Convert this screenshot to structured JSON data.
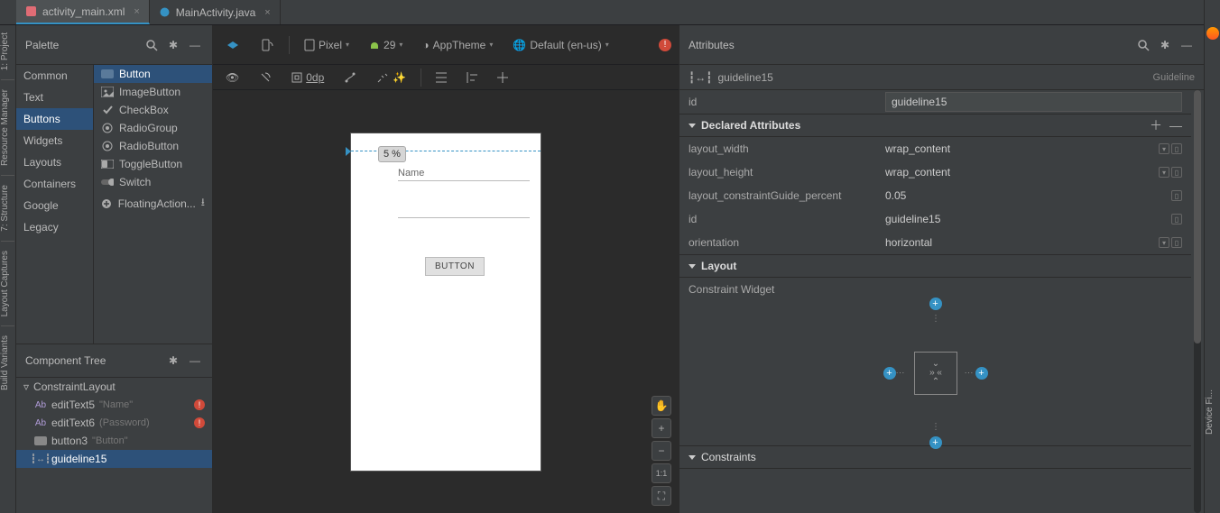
{
  "tabs": [
    {
      "name": "activity_main.xml",
      "active": true,
      "color": "#e06c75"
    },
    {
      "name": "MainActivity.java",
      "active": false,
      "color": "#3592c4"
    }
  ],
  "left_rail": [
    "1: Project",
    "Resource Manager",
    "7: Structure",
    "Layout Captures",
    "Build Variants"
  ],
  "right_rail": [
    "Device Fi..."
  ],
  "palette": {
    "title": "Palette",
    "categories": [
      "Common",
      "Text",
      "Buttons",
      "Widgets",
      "Layouts",
      "Containers",
      "Google",
      "Legacy"
    ],
    "selected_category": "Buttons",
    "widgets": [
      {
        "label": "Button",
        "icon": "button"
      },
      {
        "label": "ImageButton",
        "icon": "image"
      },
      {
        "label": "CheckBox",
        "icon": "check"
      },
      {
        "label": "RadioGroup",
        "icon": "radiogrp"
      },
      {
        "label": "RadioButton",
        "icon": "radio"
      },
      {
        "label": "ToggleButton",
        "icon": "toggle"
      },
      {
        "label": "Switch",
        "icon": "switch"
      },
      {
        "label": "FloatingAction...",
        "icon": "fab"
      }
    ],
    "selected_widget": "Button"
  },
  "component_tree": {
    "title": "Component Tree",
    "root": "ConstraintLayout",
    "children": [
      {
        "id": "editText5",
        "hint": "\"Name\"",
        "err": true,
        "icon": "text"
      },
      {
        "id": "editText6",
        "hint": "(Password)",
        "err": true,
        "icon": "text"
      },
      {
        "id": "button3",
        "hint": "\"Button\"",
        "err": false,
        "icon": "button"
      },
      {
        "id": "guideline15",
        "hint": "",
        "err": false,
        "icon": "guide",
        "sel": true
      }
    ]
  },
  "editor": {
    "device": "Pixel",
    "api": "29",
    "theme": "AppTheme",
    "locale": "Default (en-us)",
    "margin": "0dp",
    "guideline_pct": "5 %",
    "preview": {
      "name_label": "Name",
      "button_label": "BUTTON"
    },
    "zoom": {
      "pan": "✋",
      "plus": "+",
      "minus": "−",
      "fit": "1:1",
      "expand": "⛶"
    }
  },
  "attributes": {
    "title": "Attributes",
    "selected": "guideline15",
    "selected_type": "Guideline",
    "id_value": "guideline15",
    "declared_header": "Declared Attributes",
    "declared": [
      {
        "k": "layout_width",
        "v": "wrap_content",
        "combo": true
      },
      {
        "k": "layout_height",
        "v": "wrap_content",
        "combo": true
      },
      {
        "k": "layout_constraintGuide_percent",
        "v": "0.05",
        "combo": false
      },
      {
        "k": "id",
        "v": "guideline15",
        "combo": false
      },
      {
        "k": "orientation",
        "v": "horizontal",
        "combo": true
      }
    ],
    "layout_header": "Layout",
    "constraint_widget_label": "Constraint Widget",
    "constraints_header": "Constraints"
  }
}
